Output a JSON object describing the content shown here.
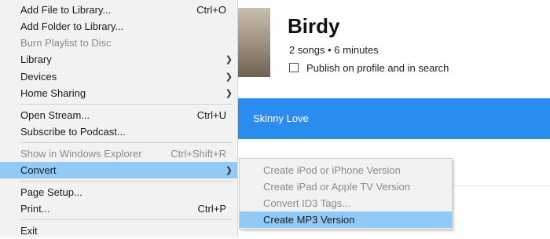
{
  "album": {
    "title": "Birdy",
    "meta": "2 songs • 6 minutes",
    "publish_label": "Publish on profile and in search"
  },
  "track": {
    "name": "Skinny Love"
  },
  "colors": {
    "accent": "#2b8cf0",
    "highlight": "#91c9f7",
    "menu_bg": "#f2f2f2"
  },
  "menu": {
    "items": [
      {
        "label": "Add File to Library...",
        "shortcut": "Ctrl+O"
      },
      {
        "label": "Add Folder to Library...",
        "shortcut": ""
      },
      {
        "label": "Burn Playlist to Disc",
        "shortcut": ""
      },
      {
        "label": "Library",
        "shortcut": ""
      },
      {
        "label": "Devices",
        "shortcut": ""
      },
      {
        "label": "Home Sharing",
        "shortcut": ""
      },
      {
        "label": "Open Stream...",
        "shortcut": "Ctrl+U"
      },
      {
        "label": "Subscribe to Podcast...",
        "shortcut": ""
      },
      {
        "label": "Show in Windows Explorer",
        "shortcut": "Ctrl+Shift+R"
      },
      {
        "label": "Convert",
        "shortcut": ""
      },
      {
        "label": "Page Setup...",
        "shortcut": ""
      },
      {
        "label": "Print...",
        "shortcut": "Ctrl+P"
      },
      {
        "label": "Exit",
        "shortcut": ""
      }
    ]
  },
  "submenu": {
    "items": [
      {
        "label": "Create iPod or iPhone Version"
      },
      {
        "label": "Create iPad or Apple TV Version"
      },
      {
        "label": "Convert ID3 Tags..."
      },
      {
        "label": "Create MP3 Version"
      }
    ]
  }
}
